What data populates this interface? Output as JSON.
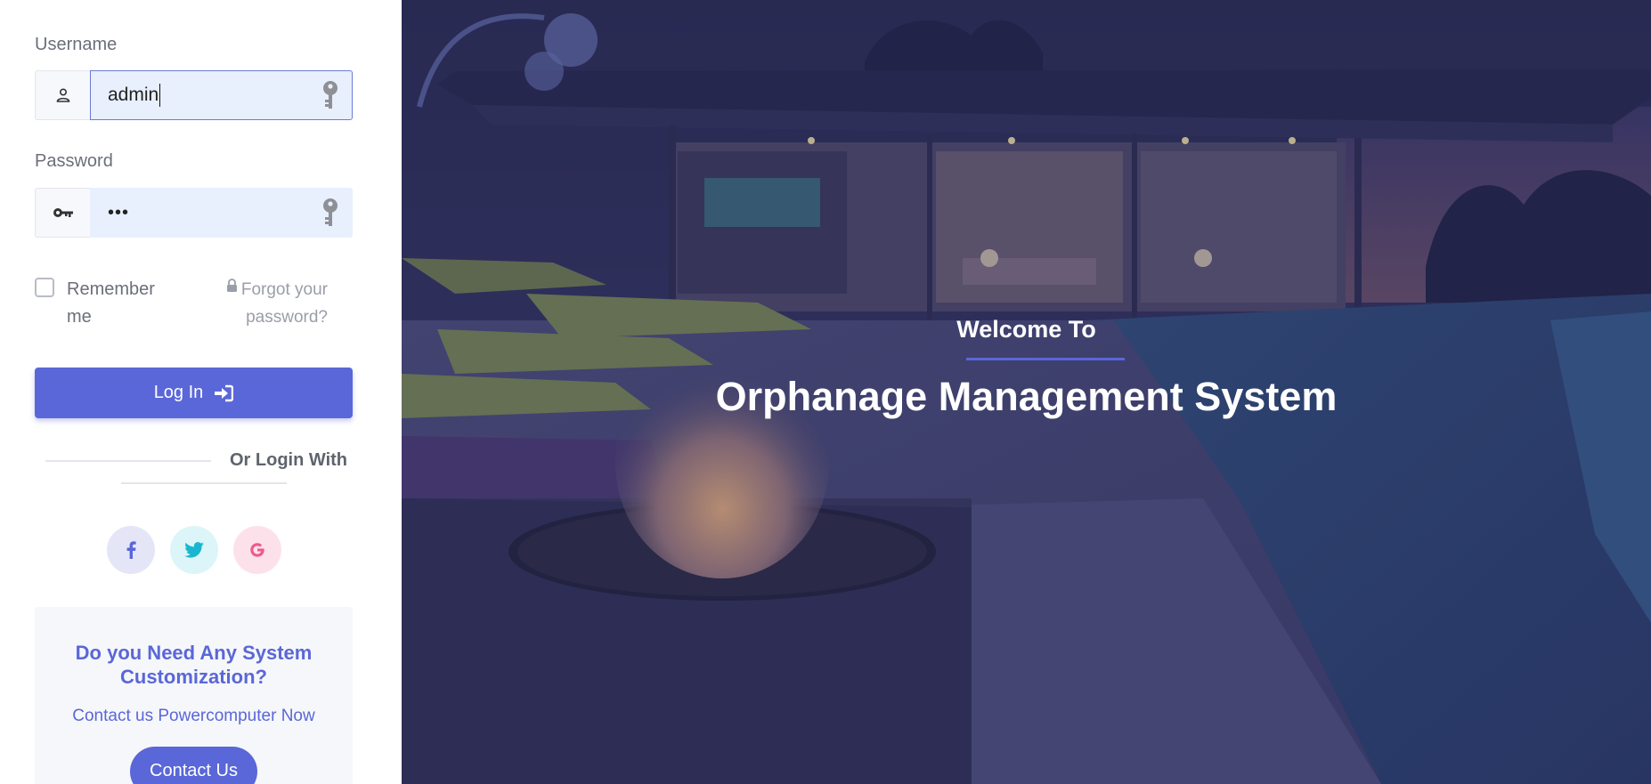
{
  "login": {
    "username_label": "Username",
    "username_value": "admin",
    "password_label": "Password",
    "password_mask": "•••",
    "remember_label": "Remember me",
    "forgot_label": "Forgot your password?",
    "login_button": "Log In",
    "or_login_with": "Or Login With"
  },
  "social": [
    {
      "name": "facebook",
      "glyph": "f"
    },
    {
      "name": "twitter",
      "glyph": "twitter"
    },
    {
      "name": "google",
      "glyph": "G"
    }
  ],
  "promo": {
    "title": "Do you Need Any System Customization?",
    "subtitle": "Contact us Powercomputer Now",
    "button": "Contact Us"
  },
  "hero": {
    "welcome": "Welcome To",
    "title": "Orphanage Management System"
  },
  "colors": {
    "accent": "#5a67d8",
    "input_bg": "#e8effd",
    "overlay": "#2e2c5c"
  }
}
